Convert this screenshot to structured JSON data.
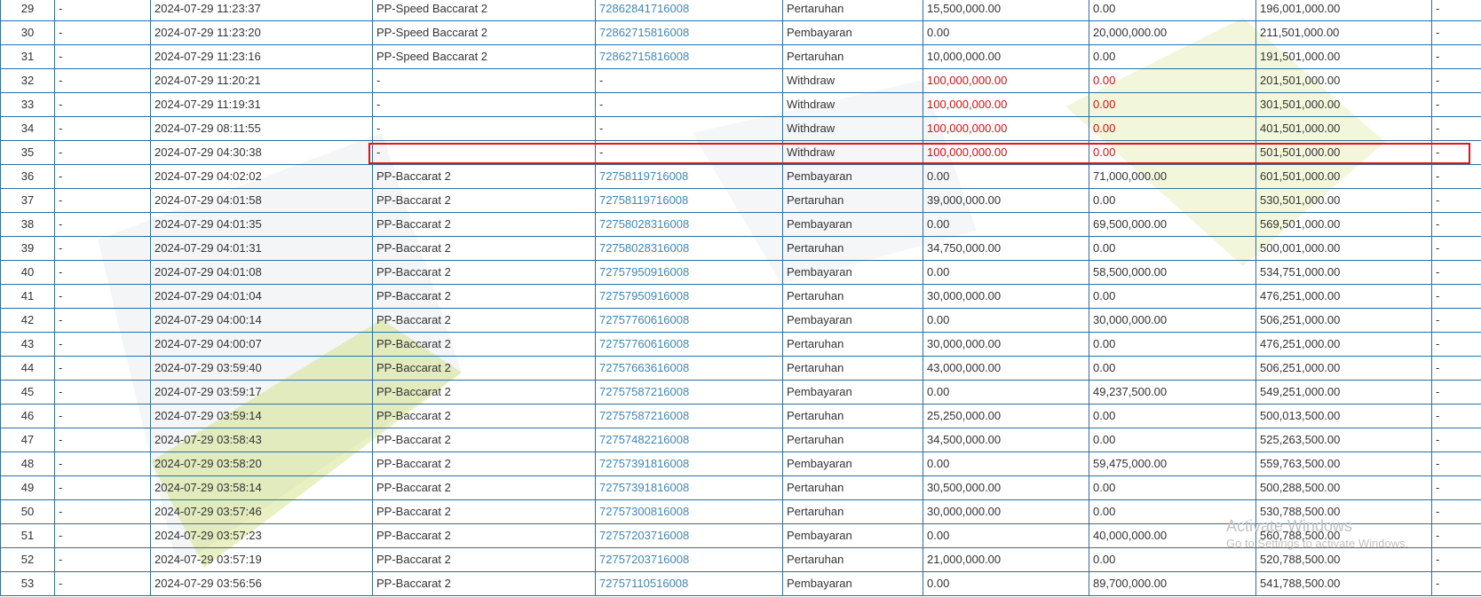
{
  "table": {
    "rows": [
      {
        "no": "29",
        "col2": "-",
        "time": "2024-07-29 11:23:37",
        "game": "PP-Speed Baccarat 2",
        "txid": "72862841716008",
        "type": "Pertaruhan",
        "debit": "15,500,000.00",
        "credit": "0.00",
        "balance": "196,001,000.00",
        "last": "-",
        "kind": "normal"
      },
      {
        "no": "30",
        "col2": "-",
        "time": "2024-07-29 11:23:20",
        "game": "PP-Speed Baccarat 2",
        "txid": "72862715816008",
        "type": "Pembayaran",
        "debit": "0.00",
        "credit": "20,000,000.00",
        "balance": "211,501,000.00",
        "last": "-",
        "kind": "normal"
      },
      {
        "no": "31",
        "col2": "-",
        "time": "2024-07-29 11:23:16",
        "game": "PP-Speed Baccarat 2",
        "txid": "72862715816008",
        "type": "Pertaruhan",
        "debit": "10,000,000.00",
        "credit": "0.00",
        "balance": "191,501,000.00",
        "last": "-",
        "kind": "normal"
      },
      {
        "no": "32",
        "col2": "-",
        "time": "2024-07-29 11:20:21",
        "game": "-",
        "txid": "-",
        "type": "Withdraw",
        "debit": "100,000,000.00",
        "credit": "0.00",
        "balance": "201,501,000.00",
        "last": "-",
        "kind": "withdraw"
      },
      {
        "no": "33",
        "col2": "-",
        "time": "2024-07-29 11:19:31",
        "game": "-",
        "txid": "-",
        "type": "Withdraw",
        "debit": "100,000,000.00",
        "credit": "0.00",
        "balance": "301,501,000.00",
        "last": "-",
        "kind": "withdraw"
      },
      {
        "no": "34",
        "col2": "-",
        "time": "2024-07-29 08:11:55",
        "game": "-",
        "txid": "-",
        "type": "Withdraw",
        "debit": "100,000,000.00",
        "credit": "0.00",
        "balance": "401,501,000.00",
        "last": "-",
        "kind": "withdraw"
      },
      {
        "no": "35",
        "col2": "-",
        "time": "2024-07-29 04:30:38",
        "game": "-",
        "txid": "-",
        "type": "Withdraw",
        "debit": "100,000,000.00",
        "credit": "0.00",
        "balance": "501,501,000.00",
        "last": "-",
        "kind": "withdraw"
      },
      {
        "no": "36",
        "col2": "-",
        "time": "2024-07-29 04:02:02",
        "game": "PP-Baccarat 2",
        "txid": "72758119716008",
        "type": "Pembayaran",
        "debit": "0.00",
        "credit": "71,000,000.00",
        "balance": "601,501,000.00",
        "last": "-",
        "kind": "normal"
      },
      {
        "no": "37",
        "col2": "-",
        "time": "2024-07-29 04:01:58",
        "game": "PP-Baccarat 2",
        "txid": "72758119716008",
        "type": "Pertaruhan",
        "debit": "39,000,000.00",
        "credit": "0.00",
        "balance": "530,501,000.00",
        "last": "-",
        "kind": "normal"
      },
      {
        "no": "38",
        "col2": "-",
        "time": "2024-07-29 04:01:35",
        "game": "PP-Baccarat 2",
        "txid": "72758028316008",
        "type": "Pembayaran",
        "debit": "0.00",
        "credit": "69,500,000.00",
        "balance": "569,501,000.00",
        "last": "-",
        "kind": "normal"
      },
      {
        "no": "39",
        "col2": "-",
        "time": "2024-07-29 04:01:31",
        "game": "PP-Baccarat 2",
        "txid": "72758028316008",
        "type": "Pertaruhan",
        "debit": "34,750,000.00",
        "credit": "0.00",
        "balance": "500,001,000.00",
        "last": "-",
        "kind": "normal"
      },
      {
        "no": "40",
        "col2": "-",
        "time": "2024-07-29 04:01:08",
        "game": "PP-Baccarat 2",
        "txid": "72757950916008",
        "type": "Pembayaran",
        "debit": "0.00",
        "credit": "58,500,000.00",
        "balance": "534,751,000.00",
        "last": "-",
        "kind": "normal"
      },
      {
        "no": "41",
        "col2": "-",
        "time": "2024-07-29 04:01:04",
        "game": "PP-Baccarat 2",
        "txid": "72757950916008",
        "type": "Pertaruhan",
        "debit": "30,000,000.00",
        "credit": "0.00",
        "balance": "476,251,000.00",
        "last": "-",
        "kind": "normal"
      },
      {
        "no": "42",
        "col2": "-",
        "time": "2024-07-29 04:00:14",
        "game": "PP-Baccarat 2",
        "txid": "72757760616008",
        "type": "Pembayaran",
        "debit": "0.00",
        "credit": "30,000,000.00",
        "balance": "506,251,000.00",
        "last": "-",
        "kind": "normal"
      },
      {
        "no": "43",
        "col2": "-",
        "time": "2024-07-29 04:00:07",
        "game": "PP-Baccarat 2",
        "txid": "72757760616008",
        "type": "Pertaruhan",
        "debit": "30,000,000.00",
        "credit": "0.00",
        "balance": "476,251,000.00",
        "last": "-",
        "kind": "normal"
      },
      {
        "no": "44",
        "col2": "-",
        "time": "2024-07-29 03:59:40",
        "game": "PP-Baccarat 2",
        "txid": "72757663616008",
        "type": "Pertaruhan",
        "debit": "43,000,000.00",
        "credit": "0.00",
        "balance": "506,251,000.00",
        "last": "-",
        "kind": "normal"
      },
      {
        "no": "45",
        "col2": "-",
        "time": "2024-07-29 03:59:17",
        "game": "PP-Baccarat 2",
        "txid": "72757587216008",
        "type": "Pembayaran",
        "debit": "0.00",
        "credit": "49,237,500.00",
        "balance": "549,251,000.00",
        "last": "-",
        "kind": "normal"
      },
      {
        "no": "46",
        "col2": "-",
        "time": "2024-07-29 03:59:14",
        "game": "PP-Baccarat 2",
        "txid": "72757587216008",
        "type": "Pertaruhan",
        "debit": "25,250,000.00",
        "credit": "0.00",
        "balance": "500,013,500.00",
        "last": "-",
        "kind": "normal"
      },
      {
        "no": "47",
        "col2": "-",
        "time": "2024-07-29 03:58:43",
        "game": "PP-Baccarat 2",
        "txid": "72757482216008",
        "type": "Pertaruhan",
        "debit": "34,500,000.00",
        "credit": "0.00",
        "balance": "525,263,500.00",
        "last": "-",
        "kind": "normal"
      },
      {
        "no": "48",
        "col2": "-",
        "time": "2024-07-29 03:58:20",
        "game": "PP-Baccarat 2",
        "txid": "72757391816008",
        "type": "Pembayaran",
        "debit": "0.00",
        "credit": "59,475,000.00",
        "balance": "559,763,500.00",
        "last": "-",
        "kind": "normal"
      },
      {
        "no": "49",
        "col2": "-",
        "time": "2024-07-29 03:58:14",
        "game": "PP-Baccarat 2",
        "txid": "72757391816008",
        "type": "Pertaruhan",
        "debit": "30,500,000.00",
        "credit": "0.00",
        "balance": "500,288,500.00",
        "last": "-",
        "kind": "normal"
      },
      {
        "no": "50",
        "col2": "-",
        "time": "2024-07-29 03:57:46",
        "game": "PP-Baccarat 2",
        "txid": "72757300816008",
        "type": "Pertaruhan",
        "debit": "30,000,000.00",
        "credit": "0.00",
        "balance": "530,788,500.00",
        "last": "-",
        "kind": "normal"
      },
      {
        "no": "51",
        "col2": "-",
        "time": "2024-07-29 03:57:23",
        "game": "PP-Baccarat 2",
        "txid": "72757203716008",
        "type": "Pembayaran",
        "debit": "0.00",
        "credit": "40,000,000.00",
        "balance": "560,788,500.00",
        "last": "-",
        "kind": "normal"
      },
      {
        "no": "52",
        "col2": "-",
        "time": "2024-07-29 03:57:19",
        "game": "PP-Baccarat 2",
        "txid": "72757203716008",
        "type": "Pertaruhan",
        "debit": "21,000,000.00",
        "credit": "0.00",
        "balance": "520,788,500.00",
        "last": "-",
        "kind": "normal"
      },
      {
        "no": "53",
        "col2": "-",
        "time": "2024-07-29 03:56:56",
        "game": "PP-Baccarat 2",
        "txid": "72757110516008",
        "type": "Pembayaran",
        "debit": "0.00",
        "credit": "89,700,000.00",
        "balance": "541,788,500.00",
        "last": "-",
        "kind": "normal"
      }
    ]
  },
  "highlight": {
    "row_no": "35",
    "color": "#e0141c"
  },
  "colors": {
    "border": "#2e6e9e",
    "link": "#3f86b4",
    "withdraw_amount": "#d01010"
  },
  "os_notice": {
    "line1": "Activate Windows",
    "line2": "Go to Settings to activate Windows."
  }
}
